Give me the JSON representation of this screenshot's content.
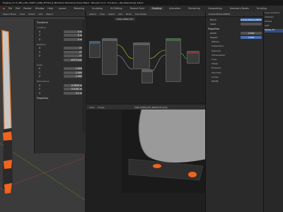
{
  "window": {
    "title": "Engines_CC-5_SB1_LPD_ASSET_LAND_PHYSO_8_MO.blend Workshop Scene Blend - Blender 4.1.0 - E:\\Users\\...\\Ma_BeamGrayL.blend"
  },
  "menubar": {
    "items": [
      "File",
      "Edit",
      "Render",
      "Window",
      "Help"
    ],
    "workspaces": [
      "Layout",
      "Modeling",
      "Sculpting",
      "UV Editing",
      "Texture Paint",
      "Shading",
      "Animation",
      "Rendering",
      "Compositing",
      "Geometry Nodes",
      "Scripting"
    ],
    "active_workspace": "Shading"
  },
  "viewport3d": {
    "header": [
      "Object Mode",
      "View",
      "Select",
      "Add",
      "Object"
    ],
    "n_panel": {
      "transform_title": "Transform",
      "location_label": "Location",
      "location": [
        {
          "axis": "X",
          "value": "0 m"
        },
        {
          "axis": "Y",
          "value": "0 m"
        },
        {
          "axis": "Z",
          "value": "0 m"
        }
      ],
      "rotation_label": "Rotation",
      "rotation": [
        {
          "axis": "X",
          "value": "0°"
        },
        {
          "axis": "Y",
          "value": "0°"
        },
        {
          "axis": "Z",
          "value": "0°"
        }
      ],
      "mode_value": "XYZ Euler",
      "scale_label": "Scale",
      "scale": [
        {
          "axis": "X",
          "value": "1.000"
        },
        {
          "axis": "Y",
          "value": "1.000"
        },
        {
          "axis": "Z",
          "value": "1.000"
        }
      ],
      "dimensions_label": "Dimensions",
      "dimensions": [
        {
          "axis": "X",
          "value": "0.2626 m"
        },
        {
          "axis": "Y",
          "value": "0.0341 m"
        },
        {
          "axis": "Z",
          "value": "3.1 m"
        }
      ],
      "properties_label": "Properties"
    }
  },
  "node_editor": {
    "header": [
      "Object",
      "View",
      "Select",
      "Add",
      "Node",
      "Use Nodes"
    ],
    "material_name": "mat_rubber_fin"
  },
  "image_editor": {
    "header": [
      "View",
      "Image"
    ],
    "image_name": "mat_rubber_fin_BaseColor.png"
  },
  "properties_panel": {
    "material_name": "RubberMaterialNEW",
    "rows": [
      {
        "label": "Name",
        "value": "RubberMaterialNEW",
        "highlight": true
      },
      {
        "label": "Label",
        "value": ""
      }
    ],
    "section": "Properties",
    "fields": [
      {
        "label": "Width",
        "value": "0.500"
      },
      {
        "label": "Height",
        "value": "0.500",
        "highlight": true
      }
    ],
    "items": [
      "Diffuse",
      "Subsurface",
      "Specular",
      "Transmission",
      "Coat",
      "Sheen",
      "Emission",
      "Thin Film",
      "Cycles",
      "EEVEE"
    ]
  },
  "outliner": {
    "items": [
      "Scene Collection",
      "Collection",
      "Camera",
      "Light",
      "Rubber_Fin"
    ],
    "selected": "Rubber_Fin"
  },
  "colors": {
    "accent": "#4772b3",
    "orange": "#f0641e",
    "background": "#1d1d1d"
  }
}
